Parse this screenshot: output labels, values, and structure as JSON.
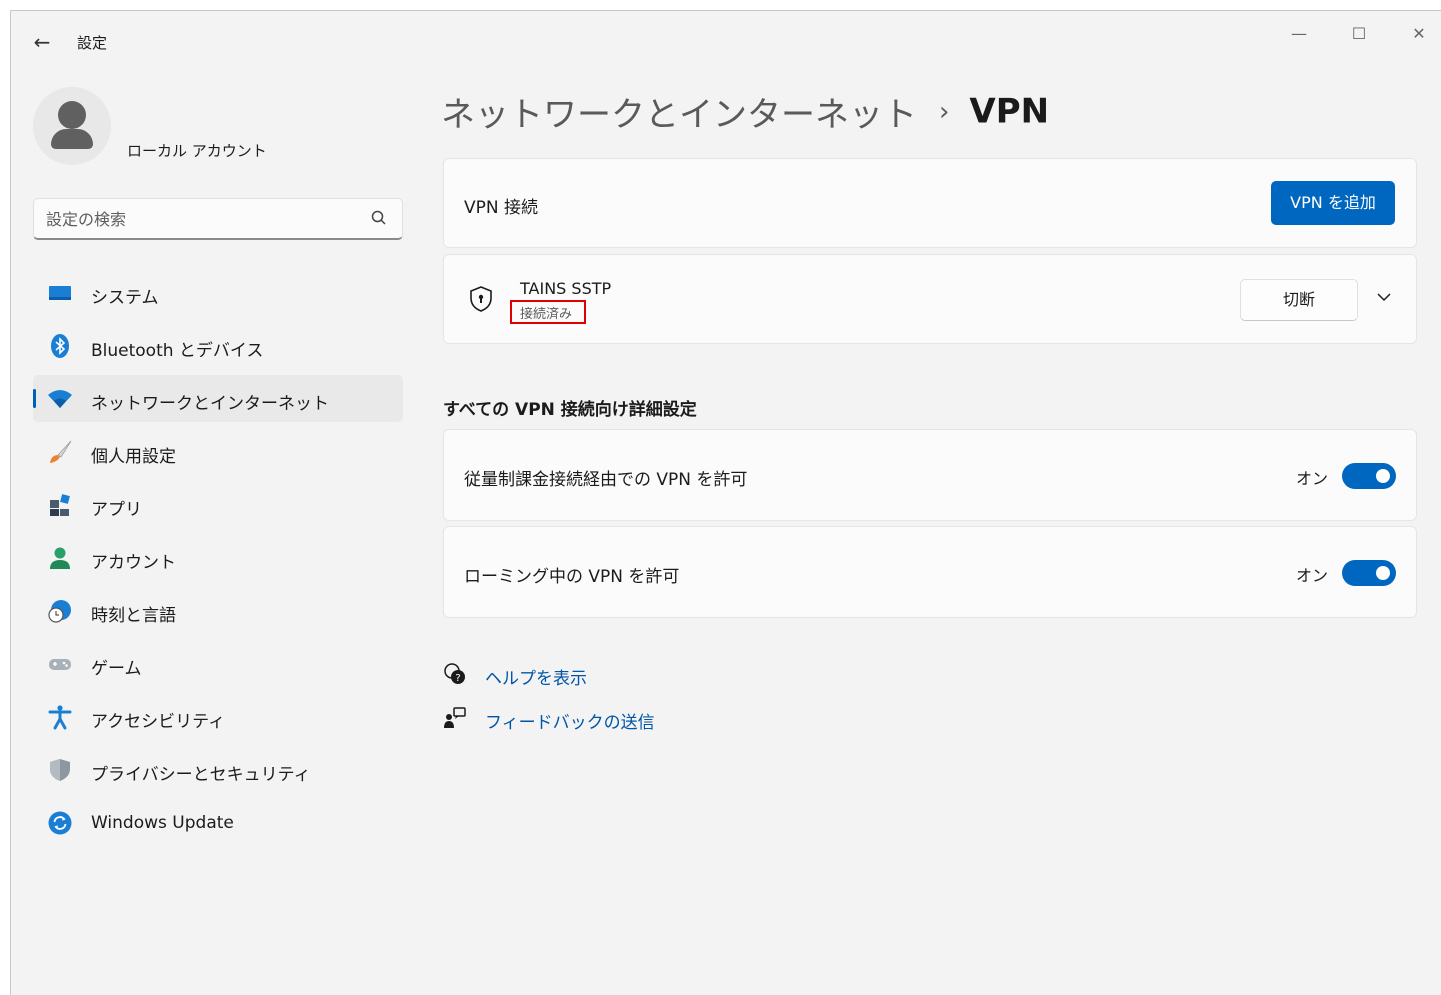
{
  "window": {
    "title": "設定",
    "controls": {
      "minimize": "—",
      "maximize": "☐",
      "close": "✕"
    }
  },
  "profile": {
    "name": "ローカル アカウント"
  },
  "search": {
    "placeholder": "設定の検索",
    "value": ""
  },
  "sidebar": {
    "items": [
      {
        "label": "システム",
        "icon": "system-icon"
      },
      {
        "label": "Bluetooth とデバイス",
        "icon": "bluetooth-icon"
      },
      {
        "label": "ネットワークとインターネット",
        "icon": "wifi-icon",
        "selected": true
      },
      {
        "label": "個人用設定",
        "icon": "brush-icon"
      },
      {
        "label": "アプリ",
        "icon": "apps-icon"
      },
      {
        "label": "アカウント",
        "icon": "account-icon"
      },
      {
        "label": "時刻と言語",
        "icon": "time-language-icon"
      },
      {
        "label": "ゲーム",
        "icon": "gamepad-icon"
      },
      {
        "label": "アクセシビリティ",
        "icon": "accessibility-icon"
      },
      {
        "label": "プライバシーとセキュリティ",
        "icon": "shield-icon"
      },
      {
        "label": "Windows Update",
        "icon": "update-icon"
      }
    ]
  },
  "breadcrumb": {
    "parent": "ネットワークとインターネット",
    "separator": "›",
    "current": "VPN"
  },
  "vpn_connections": {
    "label": "VPN 接続",
    "add_button": "VPN を追加"
  },
  "vpn_entry": {
    "name": "TAINS SSTP",
    "status": "接続済み",
    "disconnect_button": "切断"
  },
  "advanced": {
    "title": "すべての VPN 接続向け詳細設定",
    "metered": {
      "label": "従量制課金接続経由での VPN を許可",
      "state": "オン"
    },
    "roaming": {
      "label": "ローミング中の VPN を許可",
      "state": "オン"
    }
  },
  "links": {
    "help": "ヘルプを表示",
    "feedback": "フィードバックの送信"
  },
  "colors": {
    "accent": "#0067c0",
    "link": "#0055a8",
    "highlight_box": "#e00000"
  }
}
